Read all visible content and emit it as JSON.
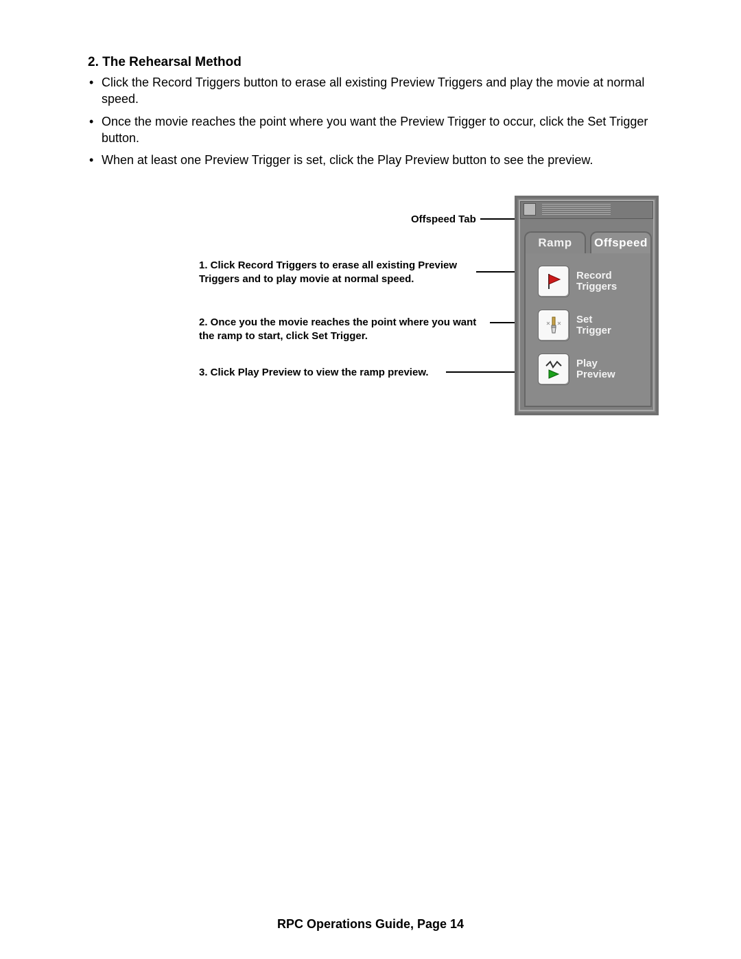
{
  "section": {
    "title": "2. The Rehearsal Method",
    "bullets": [
      "Click the Record Triggers button to erase all existing Preview Triggers and play the movie at normal speed.",
      "Once the movie reaches the point where you want the Preview Trigger to occur, click the Set Trigger button.",
      "When at least one Preview Trigger is set, click the Play Preview button to see the preview."
    ]
  },
  "callouts": {
    "c0": "Offspeed Tab",
    "c1": "1. Click Record Triggers to erase all existing Preview Triggers and to play movie at normal speed.",
    "c2": "2. Once you the movie reaches the point where you want the ramp to start, click Set Trigger.",
    "c3": "3. Click Play Preview to view the ramp preview."
  },
  "panel": {
    "tabs": {
      "ramp": "Ramp",
      "offspeed": "Offspeed"
    },
    "buttons": {
      "record": "Record\nTriggers",
      "set": "Set\nTrigger",
      "play": "Play\nPreview"
    }
  },
  "footer": "RPC Operations Guide, Page 14"
}
